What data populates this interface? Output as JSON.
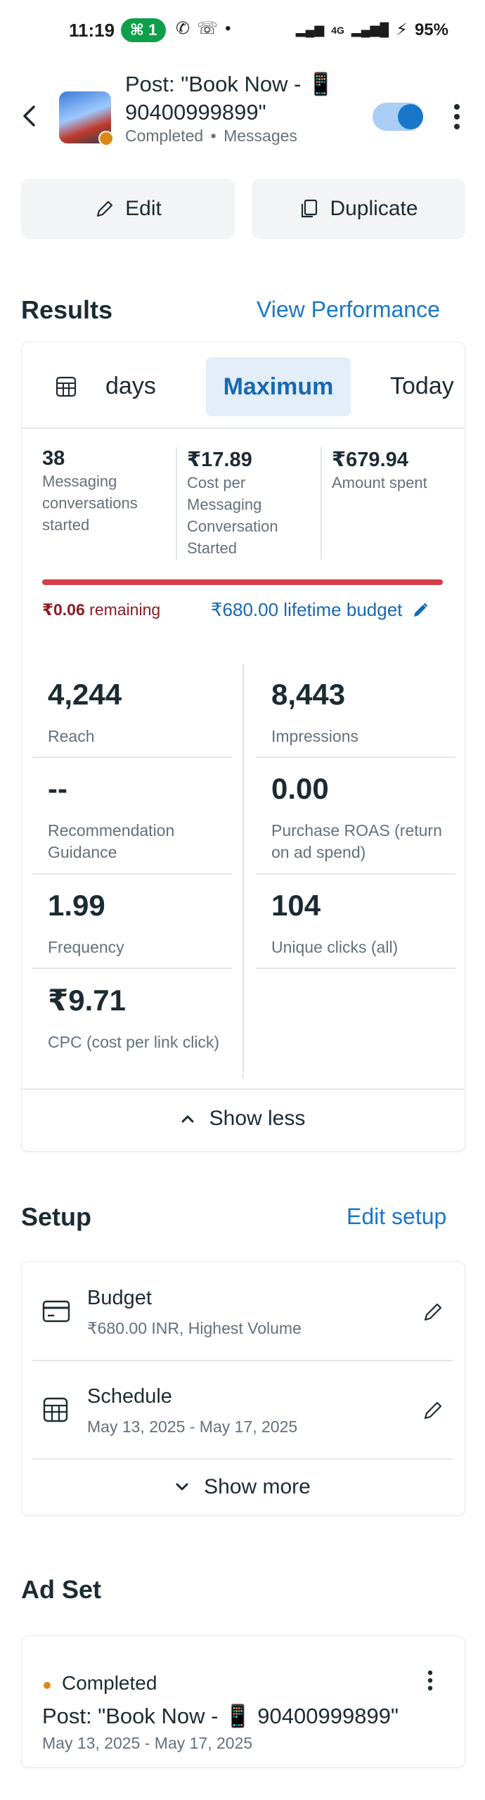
{
  "status_bar": {
    "time": "11:19",
    "hotspot_count": "1",
    "network": "4G",
    "battery": "95%"
  },
  "header": {
    "post_title": "Post: \"Book Now - 📱 90400999899\"",
    "status": "Completed",
    "separator": "•",
    "type": "Messages",
    "toggle_on": true
  },
  "actions": {
    "edit_label": "Edit",
    "duplicate_label": "Duplicate"
  },
  "results": {
    "title": "Results",
    "view_performance": "View Performance",
    "tabs": {
      "days": "days",
      "maximum": "Maximum",
      "today": "Today"
    },
    "summary": [
      {
        "value": "38",
        "label": "Messaging conversations started"
      },
      {
        "value": "₹17.89",
        "label": "Cost per Messaging Conversation Started"
      },
      {
        "value": "₹679.94",
        "label": "Amount spent"
      }
    ],
    "budget": {
      "remaining_amount": "₹0.06",
      "remaining_label": "remaining",
      "lifetime": "₹680.00 lifetime budget",
      "spent_fraction": 0.9999
    },
    "metrics": [
      {
        "value": "4,244",
        "label": "Reach"
      },
      {
        "value": "8,443",
        "label": "Impressions"
      },
      {
        "value": "--",
        "label": "Recommendation Guidance"
      },
      {
        "value": "0.00",
        "label": "Purchase ROAS (return on ad spend)"
      },
      {
        "value": "1.99",
        "label": "Frequency"
      },
      {
        "value": "104",
        "label": "Unique clicks (all)"
      },
      {
        "value": "₹9.71",
        "label": "CPC (cost per link click)"
      }
    ],
    "show_less": "Show less"
  },
  "setup": {
    "title": "Setup",
    "edit_setup": "Edit setup",
    "budget_title": "Budget",
    "budget_value": "₹680.00 INR, Highest Volume",
    "schedule_title": "Schedule",
    "schedule_value": "May 13, 2025 - May 17, 2025",
    "show_more": "Show more"
  },
  "ad_set": {
    "title": "Ad Set",
    "status": "Completed",
    "name": "Post: \"Book Now - 📱 90400999899\"",
    "dates": "May 13, 2025 - May 17, 2025"
  },
  "colors": {
    "accent": "#1877c9",
    "completed_dot": "#d98a15",
    "budget_bar": "#d73c47"
  }
}
